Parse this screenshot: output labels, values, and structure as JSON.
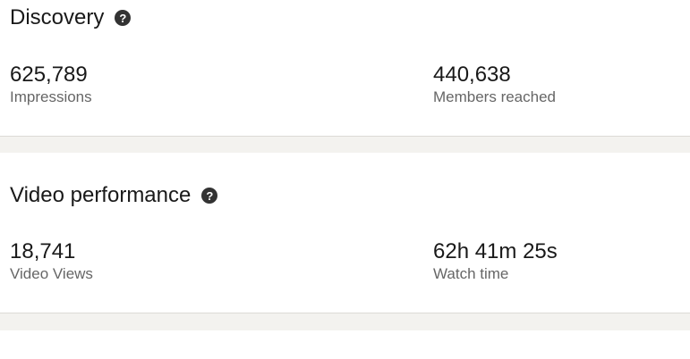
{
  "discovery": {
    "title": "Discovery",
    "metrics": [
      {
        "value": "625,789",
        "label": "Impressions"
      },
      {
        "value": "440,638",
        "label": "Members reached"
      }
    ]
  },
  "video_performance": {
    "title": "Video performance",
    "metrics": [
      {
        "value": "18,741",
        "label": "Video Views"
      },
      {
        "value": "62h 41m 25s",
        "label": "Watch time"
      }
    ]
  },
  "icons": {
    "help": "?"
  },
  "colors": {
    "page_background": "#ffffff",
    "separator_background": "#f3f2ef",
    "separator_border": "#dcdad6",
    "primary_text": "#191919",
    "secondary_text": "#666666",
    "help_icon_bg": "#333333"
  }
}
